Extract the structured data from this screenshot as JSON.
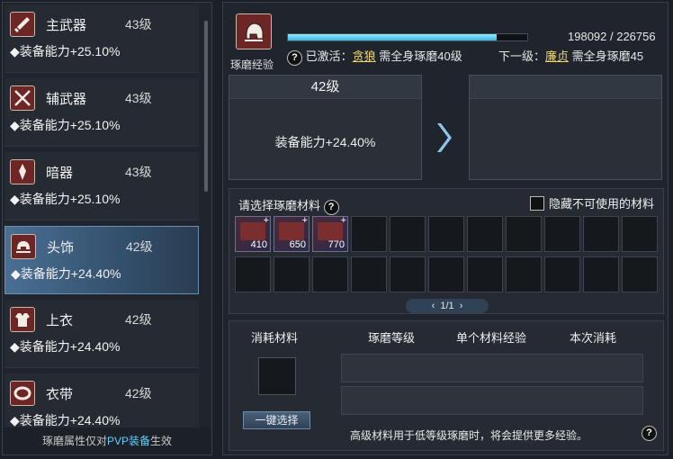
{
  "left_list": {
    "items": [
      {
        "name": "主武器",
        "level": "43级",
        "bonus": "◆装备能力+25.10%",
        "icon": "sword-icon"
      },
      {
        "name": "辅武器",
        "level": "43级",
        "bonus": "◆装备能力+25.10%",
        "icon": "crossed-swords-icon"
      },
      {
        "name": "暗器",
        "level": "43级",
        "bonus": "◆装备能力+25.10%",
        "icon": "dart-icon"
      },
      {
        "name": "头饰",
        "level": "42级",
        "bonus": "◆装备能力+24.40%",
        "icon": "helmet-icon",
        "selected": true
      },
      {
        "name": "上衣",
        "level": "42级",
        "bonus": "◆装备能力+24.40%",
        "icon": "armor-icon"
      },
      {
        "name": "衣带",
        "level": "42级",
        "bonus": "◆装备能力+24.40%",
        "icon": "belt-icon"
      }
    ],
    "footer_prefix": "琢磨属性仅对",
    "footer_highlight": "PVP装备",
    "footer_suffix": "生效"
  },
  "exp": {
    "label": "琢磨经验",
    "current": 198092,
    "max": 226756,
    "text": "198092 / 226756",
    "progress": 0.8736,
    "help": "?",
    "activated_label": "已激活：",
    "activated_name": "贪狼",
    "activated_req": " 需全身琢磨40级",
    "next_label": "下一级：",
    "next_name": "廉贞",
    "next_req": " 需全身琢磨45"
  },
  "current_level": {
    "level": "42级",
    "bonus": "装备能力+24.40%"
  },
  "materials": {
    "label": "请选择琢磨材料",
    "help": "?",
    "hide_label": "隐藏不可使用的材料",
    "row1": [
      {
        "count": "410"
      },
      {
        "count": "650"
      },
      {
        "count": "770"
      },
      {},
      {},
      {},
      {},
      {},
      {},
      {},
      {}
    ],
    "row2": [
      {},
      {},
      {},
      {},
      {},
      {},
      {},
      {},
      {},
      {},
      {}
    ],
    "page": "1/1"
  },
  "consume": {
    "col1": "消耗材料",
    "col2": "琢磨等级",
    "col3": "单个材料经验",
    "col4": "本次消耗",
    "one_key": "一键选择",
    "hint": "高级材料用于低等级琢磨时，将会提供更多经验。",
    "help": "?"
  },
  "colors": {
    "accent": "#3bb7e0",
    "highlight": "#5fd0ff",
    "link": "#f1d76a",
    "icon_bg": "#6d2626"
  }
}
